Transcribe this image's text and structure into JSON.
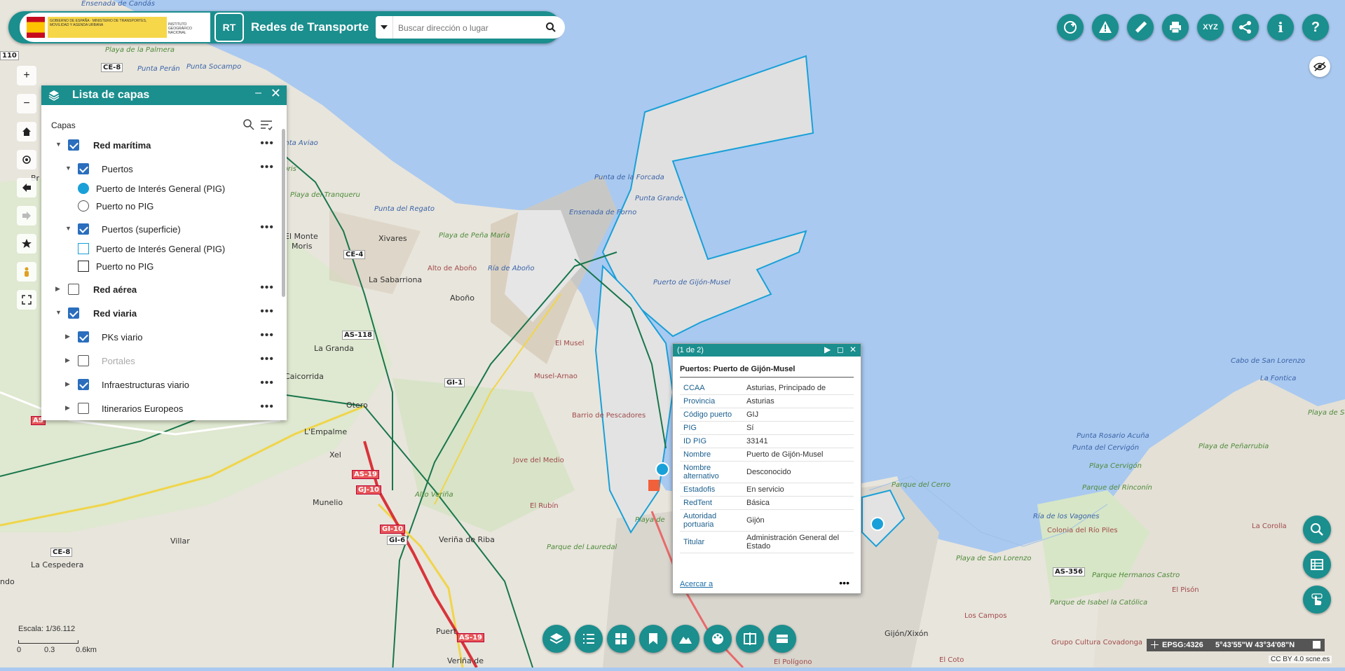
{
  "header": {
    "title": "Redes de Transporte",
    "gov_text": "GOBIERNO DE ESPAÑA · MINISTERIO DE TRANSPORTES, MOVILIDAD Y AGENDA URBANA",
    "ign_text": "INSTITUTO GEOGRÁFICO NACIONAL",
    "logo_text": "RT",
    "search_placeholder": "Buscar dirección o lugar"
  },
  "toolbar": {
    "icons": [
      "add-service-icon",
      "warning-icon",
      "measure-icon",
      "print-icon",
      "xyz-icon",
      "share-icon",
      "info-icon",
      "help-icon"
    ],
    "xyz_label": "XYZ",
    "info_label": "i",
    "help_label": "?"
  },
  "nav": {
    "zoom_in": "+",
    "zoom_out": "−"
  },
  "layers": {
    "title": "Lista de capas",
    "section": "Capas",
    "rows": [
      {
        "label": "Red marítima",
        "level": 0,
        "checked": true,
        "expanded": true,
        "bold": true
      },
      {
        "label": "Puertos",
        "level": 1,
        "checked": true,
        "expanded": true
      },
      {
        "label": "Puerto de Interés General (PIG)",
        "legend": "pig"
      },
      {
        "label": "Puerto no PIG",
        "legend": "nopig"
      },
      {
        "label": "Puertos (superficie)",
        "level": 1,
        "checked": true,
        "expanded": true
      },
      {
        "label": "Puerto de Interés General (PIG)",
        "legend": "pig-area"
      },
      {
        "label": "Puerto no PIG",
        "legend": "nopig-area"
      },
      {
        "label": "Red aérea",
        "level": 0,
        "checked": false,
        "expanded": false,
        "bold": true
      },
      {
        "label": "Red viaria",
        "level": 0,
        "checked": true,
        "expanded": true,
        "bold": true
      },
      {
        "label": "PKs viario",
        "level": 1,
        "checked": true,
        "expanded": false
      },
      {
        "label": "Portales",
        "level": 1,
        "checked": false,
        "expanded": false,
        "grey": true
      },
      {
        "label": "Infraestructuras viario",
        "level": 1,
        "checked": true,
        "expanded": false
      },
      {
        "label": "Itinerarios Europeos",
        "level": 1,
        "checked": false,
        "expanded": false
      }
    ]
  },
  "popup": {
    "count": "(1 de 2)",
    "title": "Puertos: Puerto de Gijón-Musel",
    "rows": [
      {
        "k": "CCAA",
        "v": "Asturias, Principado de"
      },
      {
        "k": "Provincia",
        "v": "Asturias"
      },
      {
        "k": "Código puerto",
        "v": "GIJ"
      },
      {
        "k": "PIG",
        "v": "Sí"
      },
      {
        "k": "ID PIG",
        "v": "33141"
      },
      {
        "k": "Nombre",
        "v": "Puerto de Gijón-Musel"
      },
      {
        "k": "Nombre alternativo",
        "v": "Desconocido"
      },
      {
        "k": "Estadofis",
        "v": "En servicio"
      },
      {
        "k": "RedTent",
        "v": "Básica"
      },
      {
        "k": "Autoridad portuaria",
        "v": "Gijón"
      },
      {
        "k": "Titular",
        "v": "Administración General del Estado"
      }
    ],
    "zoom_link": "Acercar a",
    "more": "•••"
  },
  "bottom_toolbar": [
    "layers-icon",
    "list-icon",
    "grid-icon",
    "bookmark-icon",
    "terrain-icon",
    "palette-icon",
    "compare-icon",
    "basemap-icon"
  ],
  "side_buttons": [
    "search-map-icon",
    "table-icon",
    "touch-icon"
  ],
  "scale": {
    "text": "Escala: 1/36.112",
    "ticks": [
      "0",
      "0.3",
      "0.6km"
    ]
  },
  "coords": {
    "epsg": "EPSG:4326",
    "value": "5°43'55\"W 43°34'08\"N"
  },
  "attribution": "CC BY 4.0 scne.es",
  "map_labels": [
    {
      "t": "Ensenada de Candás",
      "c": "water"
    },
    {
      "t": "Playa de la Palmera",
      "c": "green"
    },
    {
      "t": "Punta Perán",
      "c": "water"
    },
    {
      "t": "Punta Socampo",
      "c": "water"
    },
    {
      "t": "Punta Aviao",
      "c": "water"
    },
    {
      "t": "Moris",
      "c": "green"
    },
    {
      "t": "Br",
      "c": "town"
    },
    {
      "t": "Playa del Tranqueru",
      "c": "green"
    },
    {
      "t": "Punta del Regato",
      "c": "water"
    },
    {
      "t": "Xivares",
      "c": "town"
    },
    {
      "t": "Playa de Peña María",
      "c": "green"
    },
    {
      "t": "El Monte",
      "c": "town"
    },
    {
      "t": "Moris",
      "c": "town"
    },
    {
      "t": "La Sabarriona",
      "c": "town"
    },
    {
      "t": "Alto de Aboño",
      "c": "red"
    },
    {
      "t": "Ría de Aboño",
      "c": "water"
    },
    {
      "t": "Aboño",
      "c": "town"
    },
    {
      "t": "La Granda",
      "c": "town"
    },
    {
      "t": "Caicorrida",
      "c": "town"
    },
    {
      "t": "Otero",
      "c": "town"
    },
    {
      "t": "L'Empalme",
      "c": "town"
    },
    {
      "t": "Xel",
      "c": "town"
    },
    {
      "t": "Munelio",
      "c": "town"
    },
    {
      "t": "Villar",
      "c": "town"
    },
    {
      "t": "La Cespedera",
      "c": "town"
    },
    {
      "t": "ndo",
      "c": "town"
    },
    {
      "t": "Punta de la Forcada",
      "c": "water"
    },
    {
      "t": "Punta Grande",
      "c": "water"
    },
    {
      "t": "Ensenada de Forno",
      "c": "water"
    },
    {
      "t": "Puerto de Gijón-Musel",
      "c": "water"
    },
    {
      "t": "El Musel",
      "c": "red"
    },
    {
      "t": "Musel-Arnao",
      "c": "red"
    },
    {
      "t": "Barrio de Pescadores",
      "c": "red"
    },
    {
      "t": "Jove del Medio",
      "c": "red"
    },
    {
      "t": "Alto Veriña",
      "c": "green"
    },
    {
      "t": "El Rubín",
      "c": "red"
    },
    {
      "t": "Veriña de Riba",
      "c": "town"
    },
    {
      "t": "Parque del Lauredal",
      "c": "green"
    },
    {
      "t": "Veriña de",
      "c": "town"
    },
    {
      "t": "Puert",
      "c": "town"
    },
    {
      "t": "Playa de",
      "c": "green"
    },
    {
      "t": "Parque del Cerro",
      "c": "green"
    },
    {
      "t": "Ría de los Vagones",
      "c": "water"
    },
    {
      "t": "Playa de San Lorenzo",
      "c": "green"
    },
    {
      "t": "Gijón/Xixón",
      "c": "town"
    },
    {
      "t": "Los Campos",
      "c": "red"
    },
    {
      "t": "El Polígono",
      "c": "red"
    },
    {
      "t": "El Coto",
      "c": "red"
    },
    {
      "t": "Cabo de San Lorenzo",
      "c": "water"
    },
    {
      "t": "La Fontica",
      "c": "water"
    },
    {
      "t": "Playa de Serín",
      "c": "green"
    },
    {
      "t": "Punta Rosario Acuña",
      "c": "water"
    },
    {
      "t": "Punta del Cervigón",
      "c": "water"
    },
    {
      "t": "Playa de Peñarrubia",
      "c": "green"
    },
    {
      "t": "Playa Cervigón",
      "c": "green"
    },
    {
      "t": "Parque del Rinconín",
      "c": "green"
    },
    {
      "t": "Colonia del Río Piles",
      "c": "red"
    },
    {
      "t": "La Corolla",
      "c": "red"
    },
    {
      "t": "Parque Hermanos Castro",
      "c": "green"
    },
    {
      "t": "Parque de Isabel la Católica",
      "c": "green"
    },
    {
      "t": "El Pisón",
      "c": "red"
    },
    {
      "t": "Grupo Cultura Covadonga",
      "c": "red"
    }
  ],
  "road_labels": [
    {
      "t": "CE-8",
      "c": "plain"
    },
    {
      "t": "110",
      "c": "plain"
    },
    {
      "t": "CE-4",
      "c": "plain"
    },
    {
      "t": "AS-118",
      "c": "plain"
    },
    {
      "t": "GI-1",
      "c": "plain"
    },
    {
      "t": "AS-19",
      "c": "red"
    },
    {
      "t": "GJ-10",
      "c": "red"
    },
    {
      "t": "GI-10",
      "c": "red"
    },
    {
      "t": "GI-6",
      "c": "plain"
    },
    {
      "t": "AS-19",
      "c": "red"
    },
    {
      "t": "CE-8",
      "c": "plain"
    },
    {
      "t": "AS-356",
      "c": "plain"
    },
    {
      "t": "AS",
      "c": "red"
    }
  ]
}
